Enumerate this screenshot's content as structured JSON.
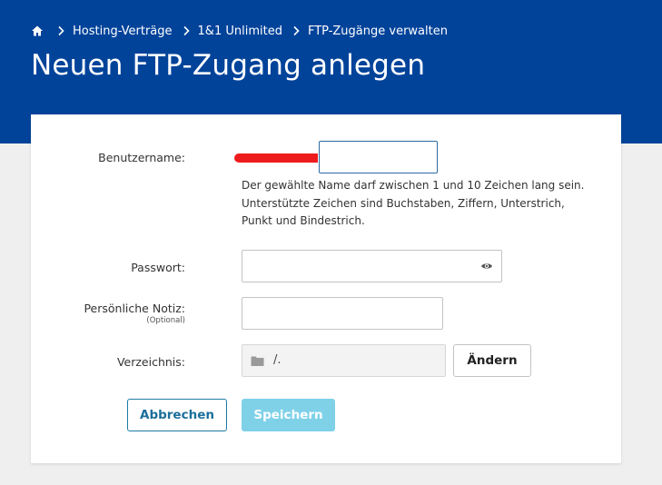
{
  "breadcrumb": {
    "items": [
      "Hosting-Verträge",
      "1&1 Unlimited",
      "FTP-Zugänge verwalten"
    ]
  },
  "page": {
    "title": "Neuen FTP-Zugang anlegen"
  },
  "form": {
    "username": {
      "label": "Benutzername:",
      "value": "",
      "hint": "Der gewählte Name darf zwischen 1 und 10 Zeichen lang sein. Unterstützte Zeichen sind Buchstaben, Ziffern, Unterstrich, Punkt und Bindestrich."
    },
    "password": {
      "label": "Passwort:",
      "value": ""
    },
    "note": {
      "label": "Persönliche Notiz:",
      "optional": "(Optional)",
      "value": ""
    },
    "directory": {
      "label": "Verzeichnis:",
      "value": "/.",
      "change_label": "Ändern"
    }
  },
  "actions": {
    "cancel_label": "Abbrechen",
    "save_label": "Speichern"
  },
  "icons": {
    "home": "home-icon",
    "separator": "chevron-right-icon",
    "password_toggle": "eye-icon",
    "folder": "folder-icon"
  },
  "colors": {
    "header": "#02439a",
    "accent": "#1c6e9a",
    "save_disabled": "#7fd1e8",
    "redaction": "#ee1c1c"
  }
}
